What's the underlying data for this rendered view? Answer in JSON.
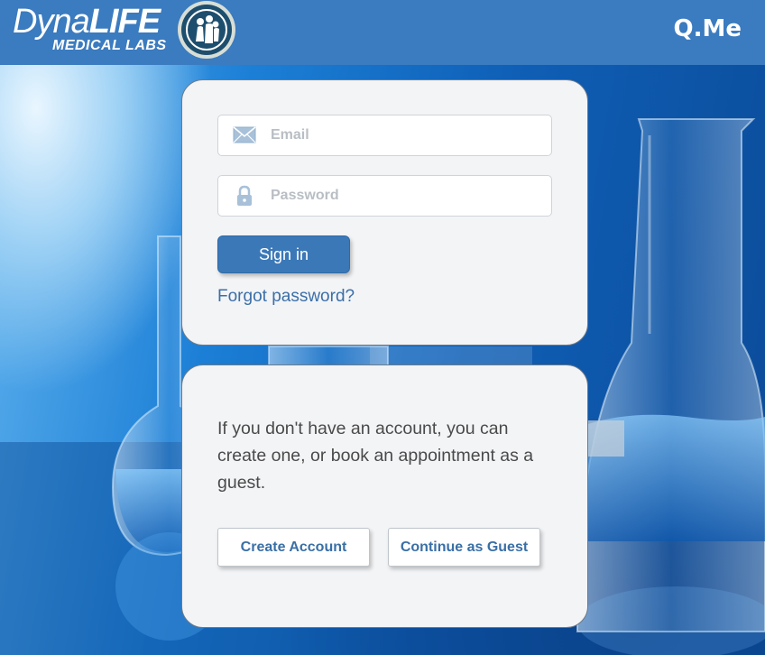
{
  "header": {
    "logo_main_thin": "Dyna",
    "logo_main_bold": "LIFE",
    "logo_sub": "MEDICAL LABS",
    "app_name": "Q.Me"
  },
  "login": {
    "email_placeholder": "Email",
    "password_placeholder": "Password",
    "signin_label": "Sign in",
    "forgot_label": "Forgot password?"
  },
  "guest": {
    "message": "If you don't have an account, you can create one, or book an appointment as a guest.",
    "create_label": "Create Account",
    "guest_label": "Continue as Guest"
  },
  "colors": {
    "header_bg": "#3b7bbf",
    "primary_button": "#3b78b8",
    "link": "#3b6fa8",
    "card_bg": "#f3f4f6"
  },
  "icons": {
    "email": "envelope-icon",
    "password": "lock-icon",
    "logo": "dynalife-badge-icon"
  }
}
